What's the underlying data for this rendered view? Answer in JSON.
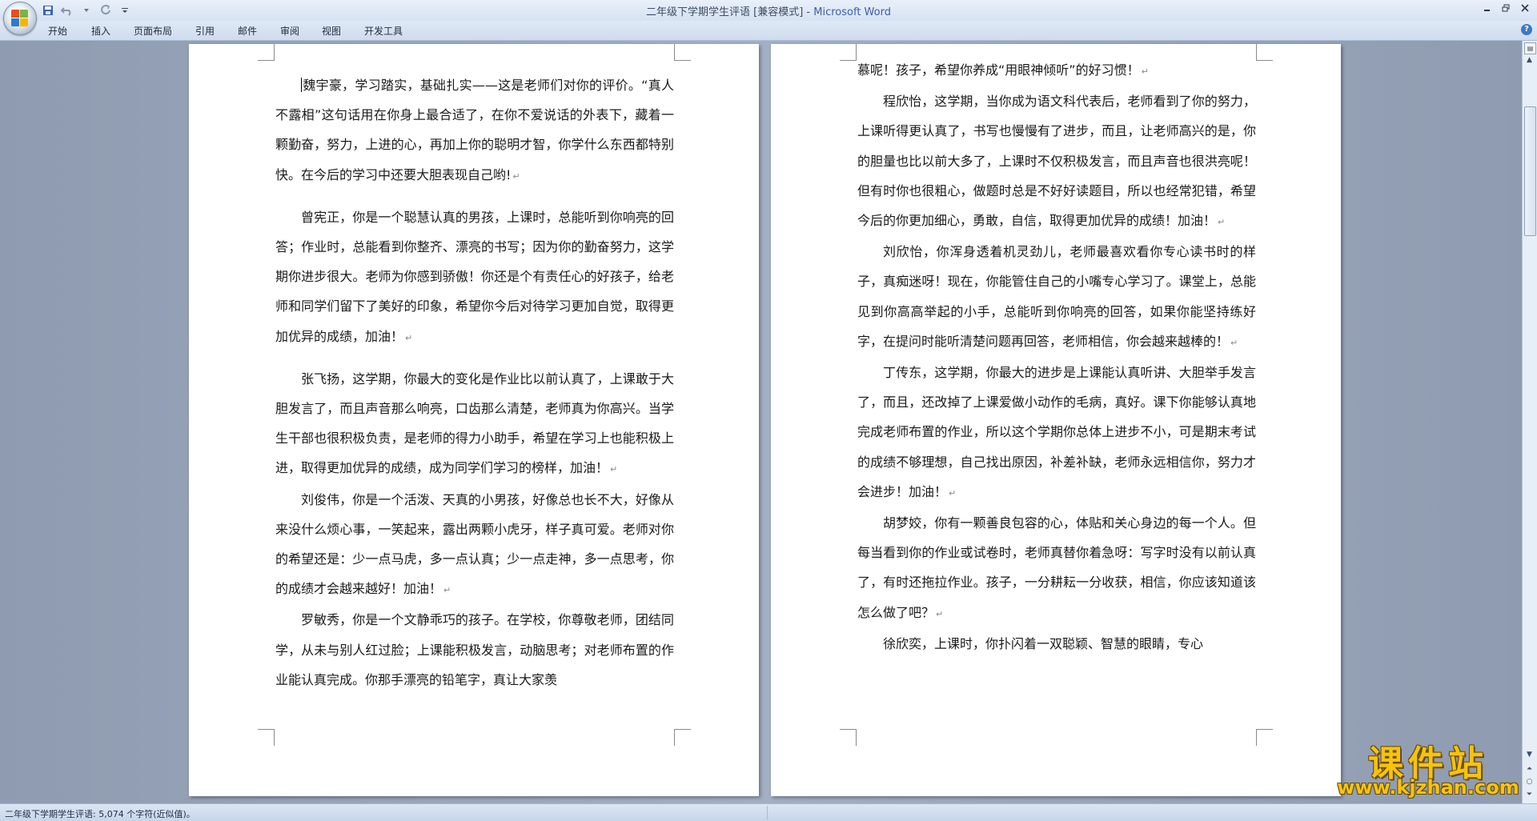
{
  "window": {
    "title": "二年级下学期学生评语 [兼容模式] - ",
    "app_name": "Microsoft Word"
  },
  "ribbon_tabs": [
    "开始",
    "插入",
    "页面布局",
    "引用",
    "邮件",
    "审阅",
    "视图",
    "开发工具"
  ],
  "left_page": {
    "paragraphs": [
      "魏宇豪，学习踏实，基础扎实——这是老师们对你的评价。“真人不露相”这句话用在你身上最合适了，在你不爱说话的外表下，藏着一颗勤奋，努力，上进的心，再加上你的聪明才智，你学什么东西都特别快。在今后的学习中还要大胆表现自己哟!",
      "曾宪正，你是一个聪慧认真的男孩，上课时，总能听到你响亮的回答；作业时，总能看到你整齐、漂亮的书写；因为你的勤奋努力，这学期你进步很大。老师为你感到骄傲！你还是个有责任心的好孩子，给老师和同学们留下了美好的印象，希望你今后对待学习更加自觉，取得更加优异的成绩，加油！",
      "张飞扬，这学期，你最大的变化是作业比以前认真了，上课敢于大胆发言了，而且声音那么响亮，口齿那么清楚，老师真为你高兴。当学生干部也很积极负责，是老师的得力小助手，希望在学习上也能积极上进，取得更加优异的成绩，成为同学们学习的榜样，加油！",
      "刘俊伟，你是一个活泼、天真的小男孩，好像总也长不大，好像从来没什么烦心事，一笑起来，露出两颗小虎牙，样子真可爱。老师对你的希望还是：少一点马虎，多一点认真；少一点走神，多一点思考，你的成绩才会越来越好！加油！",
      "罗敏秀，你是一个文静乖巧的孩子。在学校，你尊敬老师，团结同学，从未与别人红过脸；上课能积极发言，动脑思考；对老师布置的作业能认真完成。你那手漂亮的铅笔字，真让大家羡"
    ]
  },
  "right_page": {
    "paragraphs": [
      "慕呢！孩子，希望你养成“用眼神倾听”的好习惯！",
      "程欣怡，这学期，当你成为语文科代表后，老师看到了你的努力，上课听得更认真了，书写也慢慢有了进步，而且，让老师高兴的是，你的胆量也比以前大多了，上课时不仅积极发言，而且声音也很洪亮呢！但有时你也很粗心，做题时总是不好好读题目，所以也经常犯错，希望今后的你更加细心，勇敢，自信，取得更加优异的成绩！加油！",
      "刘欣怡，你浑身透着机灵劲儿，老师最喜欢看你专心读书时的样子，真痴迷呀！现在，你能管住自己的小嘴专心学习了。课堂上，总能见到你高高举起的小手，总能听到你响亮的回答，如果你能坚持练好字，在提问时能听清楚问题再回答，老师相信，你会越来越棒的！",
      "丁传东，这学期，你最大的进步是上课能认真听讲、大胆举手发言了，而且，还改掉了上课爱做小动作的毛病，真好。课下你能够认真地完成老师布置的作业，所以这个学期你总体上进步不小，可是期末考试的成绩不够理想，自己找出原因，补差补缺，老师永远相信你，努力才会进步！加油！",
      "胡梦姣，你有一颗善良包容的心，体贴和关心身边的每一个人。但每当看到你的作业或试卷时，老师真替你着急呀：写字时没有以前认真了，有时还拖拉作业。孩子，一分耕耘一分收获，相信，你应该知道该怎么做了吧？",
      "徐欣奕，上课时，你扑闪着一双聪颖、智慧的眼睛，专心"
    ]
  },
  "status_bar": {
    "text": "二年级下学期学生评语: 5,074 个字符(近似值)。"
  },
  "watermark": {
    "title": "课件站",
    "url": "www.kjzhan.com"
  },
  "colors": {
    "accent": "#3c5fa8",
    "page_background": "#ffffff",
    "workspace": "#9aa6b9",
    "watermark": "#f4c40e"
  }
}
